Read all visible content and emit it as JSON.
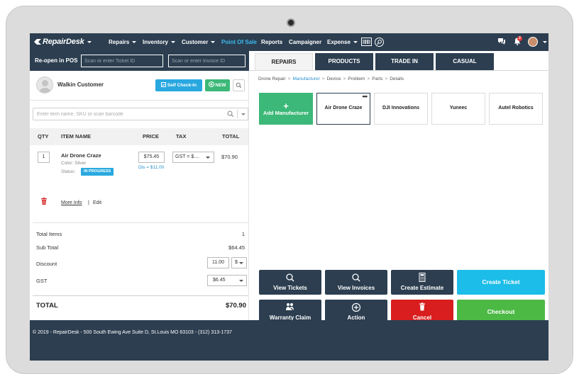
{
  "nav": {
    "logo": "RepairDesk",
    "items": [
      {
        "label": "Repairs",
        "dropdown": true
      },
      {
        "label": "Inventory",
        "dropdown": true
      },
      {
        "label": "Customer",
        "dropdown": true
      },
      {
        "label": "Point Of Sale",
        "dropdown": false,
        "active": true
      },
      {
        "label": "Reports",
        "dropdown": false
      },
      {
        "label": "Campaigner",
        "dropdown": false
      },
      {
        "label": "Expense",
        "dropdown": true
      }
    ],
    "icons": [
      "barcode-icon",
      "search-icon",
      "chat-icon",
      "bell-icon"
    ],
    "notification_count": "2",
    "accent": "#3dbcf0",
    "bar_color": "#2c3e50"
  },
  "pos": {
    "reopen_label": "Re-open in POS",
    "ticket_placeholder": "Scan or enter Ticket ID",
    "invoice_placeholder": "Scan or enter Invoice ID",
    "customer_name": "Walkin Customer",
    "checkin_label": "Self Check-In",
    "new_label": "NEW",
    "item_search_placeholder": "Enter item name, SKU or scan barcode",
    "columns": {
      "qty": "QTY",
      "item": "ITEM NAME",
      "price": "PRICE",
      "tax": "TAX",
      "total": "TOTAL"
    },
    "line_item": {
      "qty": "1",
      "name": "Air Drone Craze",
      "color": "Color: Silver",
      "status_label": "Status:",
      "status": "IN PROGRESS",
      "price": "$75.45",
      "discount": "Dis = $11.00",
      "tax": "GST = $....",
      "total": "$70.90",
      "more_info": "More Info",
      "separator": "|",
      "edit": "Edit"
    },
    "summary": {
      "total_items_label": "Total Items",
      "total_items": "1",
      "subtotal_label": "Sub Total",
      "subtotal": "$64.45",
      "discount_label": "Discount",
      "discount_value": "11.00",
      "discount_unit": "$",
      "gst_label": "GST",
      "gst_value": "$6.45",
      "total_label": "TOTAL",
      "total": "$70.90"
    }
  },
  "tabs": [
    {
      "label": "REPAIRS",
      "active": true
    },
    {
      "label": "PRODUCTS",
      "active": false
    },
    {
      "label": "TRADE IN",
      "active": false
    },
    {
      "label": "CASUAL",
      "active": false
    }
  ],
  "breadcrumb": [
    "Drone Repair",
    "Manufacturer",
    "Device",
    "Problem",
    "Parts",
    "Details"
  ],
  "breadcrumb_current": "Manufacturer",
  "manufacturers": {
    "add_label": "Add Manufacturer",
    "items": [
      "Air Drone Craze",
      "DJI Innovations",
      "Yuneec",
      "Autel Robotics"
    ],
    "more": "•••"
  },
  "actions": {
    "view_tickets": "View Tickets",
    "view_invoices": "View Invoices",
    "create_estimate": "Create Estimate",
    "create_ticket": "Create Ticket",
    "warranty_claim": "Warranty Claim",
    "action": "Action",
    "cancel": "Cancel",
    "checkout": "Checkout"
  },
  "colors": {
    "create_ticket": "#1cbde8",
    "checkout": "#4cb944",
    "cancel": "#d81e1e",
    "add_tile": "#3cb878",
    "dark": "#2c3e50"
  },
  "footer": "© 2019 - RepairDesk - 500 South Ewing Ave Suite D, St.Louis MO 63103  -  (312) 313-1737"
}
